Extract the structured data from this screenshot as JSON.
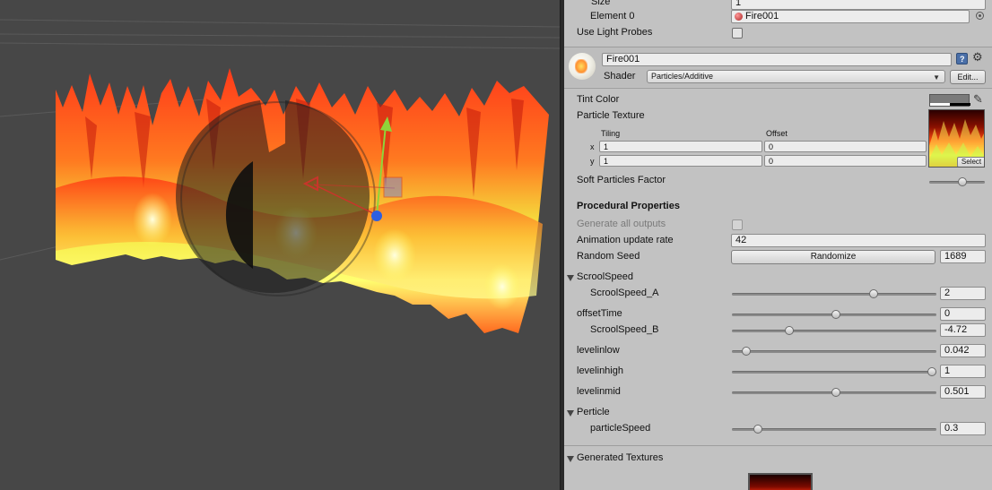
{
  "renderer": {
    "size_label": "Size",
    "size_value": "1",
    "element0_label": "Element 0",
    "element0_value": "Fire001",
    "light_probes_label": "Use Light Probes"
  },
  "material": {
    "name": "Fire001",
    "shader_label": "Shader",
    "shader_value": "Particles/Additive",
    "edit_label": "Edit..."
  },
  "properties": {
    "tint_color_label": "Tint Color",
    "particle_texture_label": "Particle Texture",
    "tiling_label": "Tiling",
    "offset_label": "Offset",
    "x_label": "x",
    "y_label": "y",
    "tiling_x": "1",
    "tiling_y": "1",
    "offset_x": "0",
    "offset_y": "0",
    "select_label": "Select",
    "soft_particles_label": "Soft Particles Factor",
    "soft_particles_level": 0.62
  },
  "procedural": {
    "header": "Procedural Properties",
    "generate_all_label": "Generate all outputs",
    "anim_rate_label": "Animation update rate",
    "anim_rate_value": "42",
    "random_seed_label": "Random Seed",
    "randomize_label": "Randomize",
    "random_seed_value": "1689"
  },
  "groups": {
    "scroolspeed": "ScroolSpeed",
    "perticle": "Perticle",
    "generated_textures": "Generated Textures"
  },
  "sliders": [
    {
      "label": "ScroolSpeed_A",
      "value": "2",
      "level": 0.7
    },
    {
      "label": "offsetTime",
      "value": "0",
      "level": 0.51
    },
    {
      "label": "ScroolSpeed_B",
      "value": "-4.72",
      "level": 0.27
    },
    {
      "label": "levelinlow",
      "value": "0.042",
      "level": 0.05
    },
    {
      "label": "levelinhigh",
      "value": "1",
      "level": 1.0
    },
    {
      "label": "levelinmid",
      "value": "0.501",
      "level": 0.51
    },
    {
      "label": "particleSpeed",
      "value": "0.3",
      "level": 0.11
    }
  ],
  "colors": {
    "inspector_bg": "#c2c2c2",
    "scene_bg": "#474747",
    "gizmo_y": "#8fd43a",
    "gizmo_x": "#c8352b",
    "gizmo_z": "#2e5fe0"
  }
}
